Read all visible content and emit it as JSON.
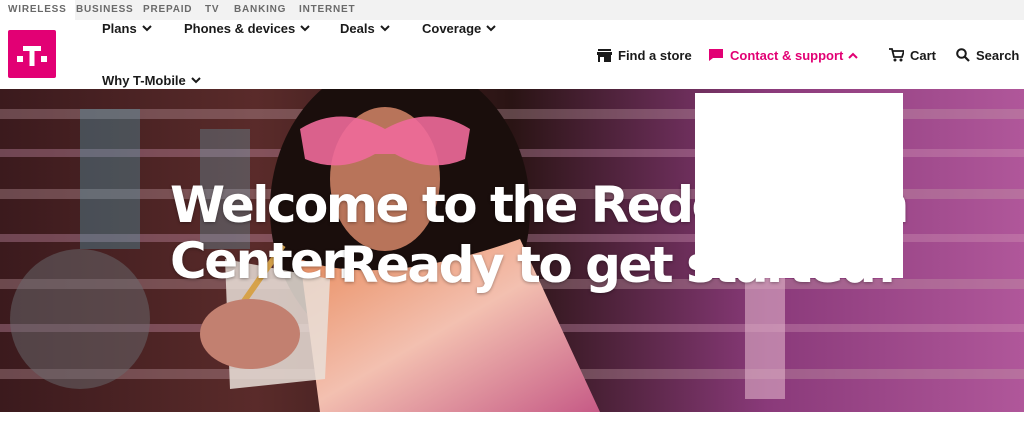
{
  "segments": [
    "WIRELESS",
    "BUSINESS",
    "PREPAID",
    "TV",
    "BANKING",
    "INTERNET"
  ],
  "nav": {
    "plans": "Plans",
    "phones": "Phones & devices",
    "deals": "Deals",
    "coverage": "Coverage",
    "why": "Why T-Mobile"
  },
  "utility": {
    "find_store": "Find a store",
    "contact": "Contact & support",
    "cart": "Cart",
    "search": "Search"
  },
  "hero": {
    "line1": "Welcome to the Redemption Center.",
    "line2": "Ready to get started?"
  },
  "colors": {
    "brand": "#e20074",
    "text": "#1a1a1a",
    "topbar_bg": "#f2f2f2"
  },
  "icons": [
    "t-mobile-logo",
    "chevron-down-icon",
    "store-icon",
    "chat-icon",
    "chevron-up-icon",
    "cart-icon",
    "search-icon"
  ]
}
